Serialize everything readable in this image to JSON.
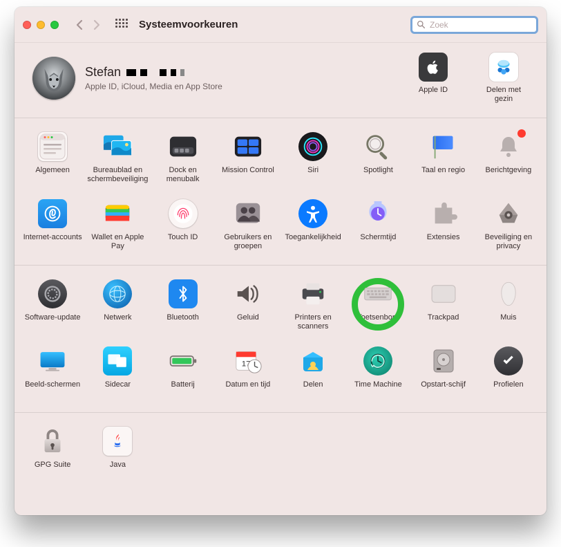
{
  "window": {
    "title": "Systeemvoorkeuren"
  },
  "search": {
    "placeholder": "Zoek",
    "value": ""
  },
  "account": {
    "name": "Stefan",
    "subtitle": "Apple ID, iCloud, Media en App Store",
    "right": [
      {
        "key": "apple-id",
        "label": "Apple ID"
      },
      {
        "key": "family",
        "label": "Delen met gezin"
      }
    ]
  },
  "sections": [
    {
      "items": [
        {
          "key": "general",
          "label": "Algemeen"
        },
        {
          "key": "desktop-screensaver",
          "label": "Bureaublad en schermbeveiliging"
        },
        {
          "key": "dock",
          "label": "Dock en menubalk"
        },
        {
          "key": "mission-control",
          "label": "Mission Control"
        },
        {
          "key": "siri",
          "label": "Siri"
        },
        {
          "key": "spotlight",
          "label": "Spotlight"
        },
        {
          "key": "language-region",
          "label": "Taal en regio"
        },
        {
          "key": "notifications",
          "label": "Berichtgeving"
        },
        {
          "key": "internet-accounts",
          "label": "Internet-accounts"
        },
        {
          "key": "wallet",
          "label": "Wallet en Apple Pay"
        },
        {
          "key": "touch-id",
          "label": "Touch ID"
        },
        {
          "key": "users-groups",
          "label": "Gebruikers en groepen"
        },
        {
          "key": "accessibility",
          "label": "Toegankelijkheid"
        },
        {
          "key": "screen-time",
          "label": "Schermtijd"
        },
        {
          "key": "extensions",
          "label": "Extensies"
        },
        {
          "key": "security",
          "label": "Beveiliging en privacy"
        }
      ]
    },
    {
      "items": [
        {
          "key": "software-update",
          "label": "Software-update"
        },
        {
          "key": "network",
          "label": "Netwerk"
        },
        {
          "key": "bluetooth",
          "label": "Bluetooth"
        },
        {
          "key": "sound",
          "label": "Geluid"
        },
        {
          "key": "printers",
          "label": "Printers en scanners"
        },
        {
          "key": "keyboard",
          "label": "Toetsenbord",
          "highlighted": true
        },
        {
          "key": "trackpad",
          "label": "Trackpad"
        },
        {
          "key": "mouse",
          "label": "Muis"
        },
        {
          "key": "displays",
          "label": "Beeld-schermen"
        },
        {
          "key": "sidecar",
          "label": "Sidecar"
        },
        {
          "key": "battery",
          "label": "Batterij"
        },
        {
          "key": "date-time",
          "label": "Datum en tijd"
        },
        {
          "key": "sharing",
          "label": "Delen"
        },
        {
          "key": "time-machine",
          "label": "Time Machine"
        },
        {
          "key": "startup-disk",
          "label": "Opstart-schijf"
        },
        {
          "key": "profiles",
          "label": "Profielen"
        }
      ]
    },
    {
      "items": [
        {
          "key": "gpg-suite",
          "label": "GPG Suite"
        },
        {
          "key": "java",
          "label": "Java"
        }
      ]
    }
  ]
}
